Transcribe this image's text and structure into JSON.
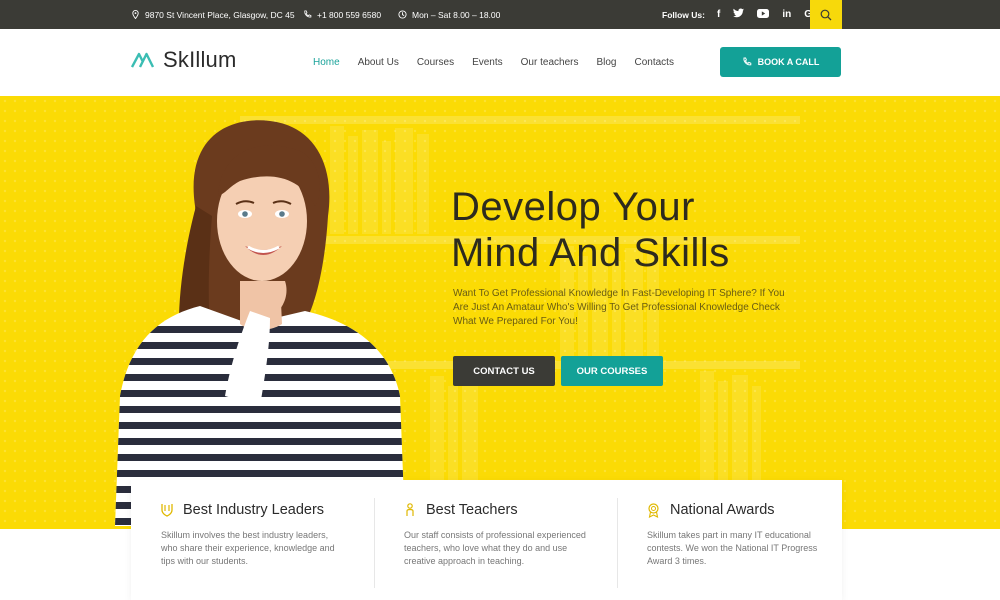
{
  "topbar": {
    "address": "9870 St Vincent Place, Glasgow, DC 45",
    "phone": "+1 800 559 6580",
    "hours": "Mon – Sat 8.00 – 18.00",
    "follow_label": "Follow Us:",
    "social": [
      "f",
      "t",
      "yt",
      "in",
      "G+"
    ],
    "social_icons": [
      "facebook-icon",
      "twitter-icon",
      "youtube-icon",
      "linkedin-icon",
      "google-plus-icon"
    ]
  },
  "header": {
    "logo": "SkIllum",
    "nav": [
      "Home",
      "About Us",
      "Courses",
      "Events",
      "Our teachers",
      "Blog",
      "Contacts"
    ],
    "active_nav": "Home",
    "book_button": "BOOK A CALL"
  },
  "hero": {
    "title_line1": "Develop Your",
    "title_line2": "Mind And Skills",
    "subtitle": "Want To Get Professional Knowledge In Fast-Developing IT Sphere? If You Are Just An Amataur Who's Willing To Get Professional Knowledge Check What We Prepared For You!",
    "contact_button": "CONTACT US",
    "courses_button": "OUR COURSES"
  },
  "features": [
    {
      "title": "Best Industry Leaders",
      "text": "Skillum involves the best industry leaders, who share their experience, knowledge and tips with our students.",
      "icon": "leaders-icon"
    },
    {
      "title": "Best Teachers",
      "text": "Our staff consists of professional experienced teachers, who love what they do and use creative approach in teaching.",
      "icon": "teacher-icon"
    },
    {
      "title": "National Awards",
      "text": "Skillum takes part in many IT educational contests. We won the National IT Progress Award 3 times.",
      "icon": "award-icon"
    }
  ],
  "colors": {
    "accent": "#13a197",
    "yellow": "#fbdb05",
    "dark": "#3b3b36"
  }
}
